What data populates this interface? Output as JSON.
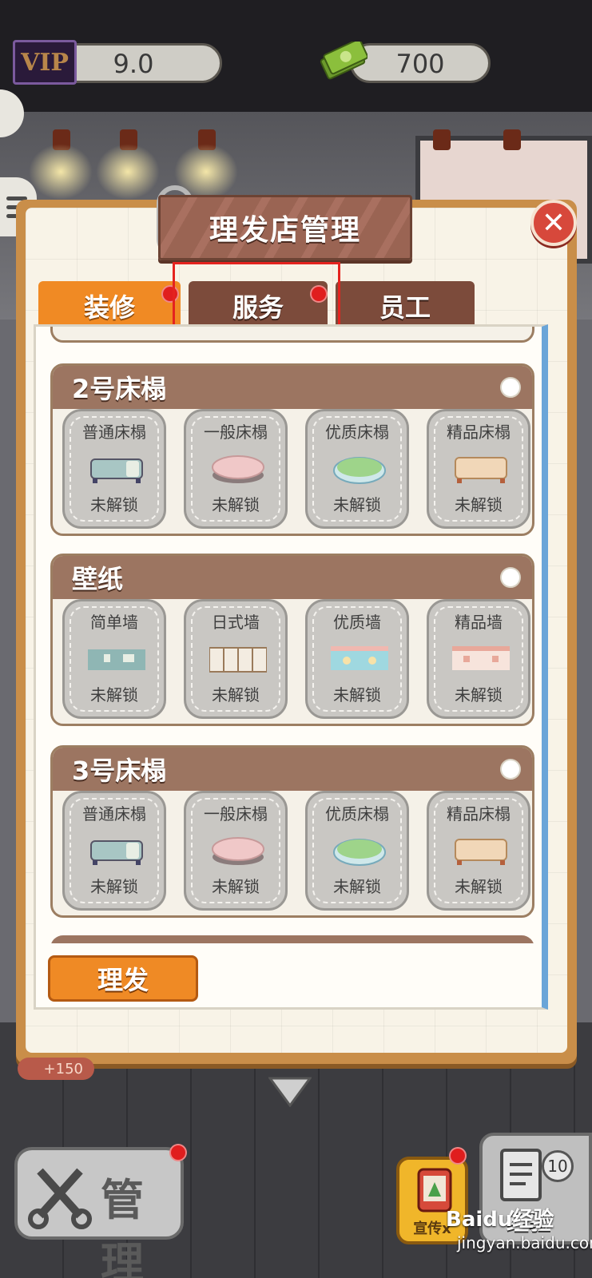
{
  "topbar": {
    "vip_label": "VIP",
    "vip_value": "9.0",
    "cash_value": "700"
  },
  "panel": {
    "title": "理发店管理",
    "tabs": [
      {
        "label": "装修",
        "active": true,
        "has_dot": true
      },
      {
        "label": "服务",
        "active": false,
        "has_dot": true
      },
      {
        "label": "员工",
        "active": false,
        "has_dot": false
      }
    ],
    "sections": [
      {
        "title": "2号床榻",
        "items": [
          {
            "name": "普通床榻",
            "status": "未解锁",
            "icon": "bed-basic-icon"
          },
          {
            "name": "一般床榻",
            "status": "未解锁",
            "icon": "bed-pink-icon"
          },
          {
            "name": "优质床榻",
            "status": "未解锁",
            "icon": "bed-green-icon"
          },
          {
            "name": "精品床榻",
            "status": "未解锁",
            "icon": "bed-premium-icon"
          }
        ]
      },
      {
        "title": "壁纸",
        "items": [
          {
            "name": "简单墙",
            "status": "未解锁",
            "icon": "wall-simple-icon"
          },
          {
            "name": "日式墙",
            "status": "未解锁",
            "icon": "wall-japanese-icon"
          },
          {
            "name": "优质墙",
            "status": "未解锁",
            "icon": "wall-quality-icon"
          },
          {
            "name": "精品墙",
            "status": "未解锁",
            "icon": "wall-premium-icon"
          }
        ]
      },
      {
        "title": "3号床榻",
        "items": [
          {
            "name": "普通床榻",
            "status": "未解锁",
            "icon": "bed-basic-icon"
          },
          {
            "name": "一般床榻",
            "status": "未解锁",
            "icon": "bed-pink-icon"
          },
          {
            "name": "优质床榻",
            "status": "未解锁",
            "icon": "bed-green-icon"
          },
          {
            "name": "精品床榻",
            "status": "未解锁",
            "icon": "bed-premium-icon"
          }
        ]
      }
    ],
    "haircut_button": "理发"
  },
  "hud": {
    "income_badge": "+150",
    "manage_label": "管理",
    "promo_label": "宣传x",
    "exp_label": "经验",
    "exp_count": "10",
    "watermark": "Baidu经验",
    "watermark_sub": "jingyan.baidu.com"
  },
  "colors": {
    "accent": "#f08a24",
    "tab_inactive": "#7c4b3b",
    "section_header": "#9c7561",
    "highlight": "#e4231f",
    "dot": "#e01e1e"
  }
}
